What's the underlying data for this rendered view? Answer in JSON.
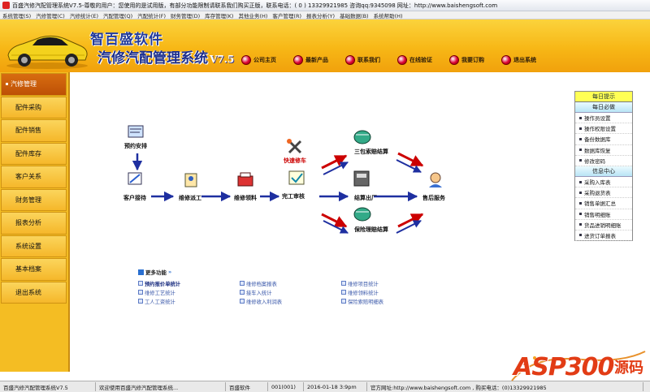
{
  "window": {
    "title": "百盛汽修汽配管理系统V7.5-尊敬的用户：您使用的是试用版，有部分功能限制请联系我们购买正版，联系电话：( 0 ) 13329921985  咨询qq:9345098  网址：http://www.baishengsoft.com"
  },
  "menu": {
    "items": [
      "系统管理(S)",
      "汽修管理(C)",
      "汽修统计(E)",
      "汽配管理(Q)",
      "汽配统计(F)",
      "财务管理(D)",
      "库存管理(K)",
      "其他业务(H)",
      "客户管理(R)",
      "报表分析(Y)",
      "基础数据(B)",
      "系统帮助(H)"
    ]
  },
  "banner": {
    "brand": "智百盛软件",
    "product": "汽修汽配管理系统",
    "version": "V7.5",
    "links": [
      {
        "label": "公司主页",
        "icon": "home-icon"
      },
      {
        "label": "最新产品",
        "icon": "new-product-icon"
      },
      {
        "label": "联系我们",
        "icon": "contact-icon"
      },
      {
        "label": "在线验证",
        "icon": "verify-icon"
      },
      {
        "label": "我要订购",
        "icon": "order-icon"
      },
      {
        "label": "退出系统",
        "icon": "exit-icon"
      }
    ]
  },
  "sidebar": {
    "items": [
      "汽修管理",
      "配件采购",
      "配件销售",
      "配件库存",
      "客户关系",
      "财务管理",
      "报表分析",
      "系统设置",
      "基本档案",
      "退出系统"
    ],
    "active_index": 0
  },
  "flow": {
    "nodes": {
      "appointment": "预约安排",
      "reception": "客户接待",
      "inspection": "维修派工",
      "material": "维修领料",
      "completion": "完工审核",
      "quick_repair": "快速修车",
      "three_guarantee": "三包索赔结算",
      "settlement": "结算出厂",
      "insurance": "保险理赔结算",
      "after_sales": "售后服务"
    }
  },
  "more": {
    "title": "更多功能",
    "columns": [
      [
        "预约报价单统计",
        "维修工艺统计",
        "工人工资统计"
      ],
      [
        "维修档案报表",
        "接车入统计",
        "维修收入利润表"
      ],
      [
        "维修项目统计",
        "维修领料统计",
        "保险索赔明细表"
      ]
    ]
  },
  "rightpanel": {
    "header": "每日提示",
    "sections": [
      {
        "title": "每日必做",
        "items": [
          "操作员设置",
          "操作权限设置",
          "备份数据库",
          "数据库恢复",
          "修改密码"
        ]
      },
      {
        "title": "信息中心",
        "items": [
          "采购入库表",
          "采购退货表",
          "销售单据汇总",
          "销售明细账",
          "货品进销明细账",
          "进货订单报表"
        ]
      }
    ]
  },
  "statusbar": {
    "cells": [
      "百盛汽修汽配管理系统V7.5",
      "欢迎使用百盛汽修汽配管理系统...",
      "百盛软件",
      "001(001)",
      "2016-01-18 3:9pm",
      "官方网址:http://www.baishengsoft.com , 购买电话：(0)13329921985"
    ]
  },
  "watermark": {
    "text": "ASP300",
    "suffix": "源码"
  },
  "colors": {
    "banner": "#f7b716",
    "sidebar": "#f4bd23",
    "active": "#c85a08",
    "accent_blue": "#1e2fa0",
    "accent_red": "#c00"
  }
}
